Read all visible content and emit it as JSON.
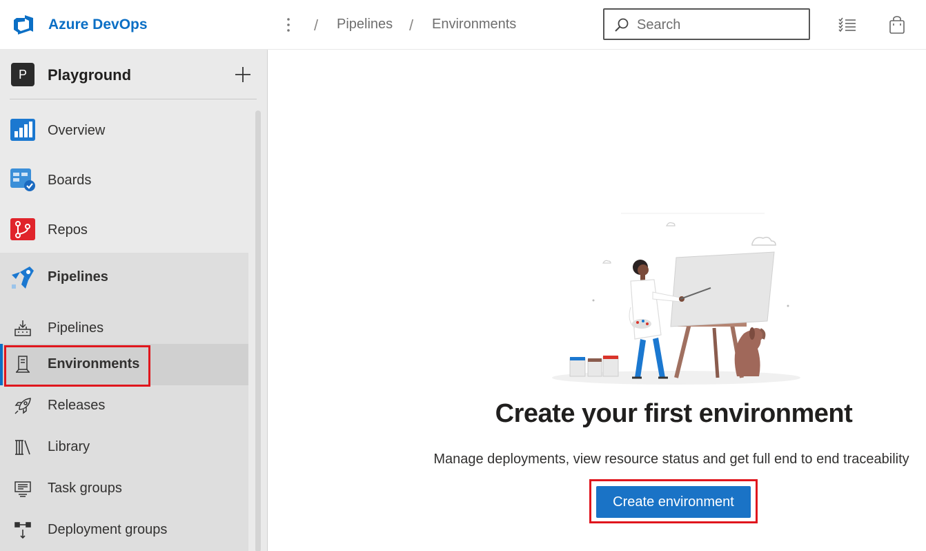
{
  "header": {
    "logo_text": "Azure DevOps",
    "breadcrumb": [
      "Pipelines",
      "Environments"
    ],
    "search_placeholder": "Search",
    "icons": [
      "azure-devops-logo-icon",
      "more-vertical-icon",
      "search-icon",
      "task-list-icon",
      "shopping-bag-icon"
    ]
  },
  "sidebar": {
    "project": {
      "initial": "P",
      "name": "Playground"
    },
    "items": [
      {
        "label": "Overview",
        "icon": "overview-icon"
      },
      {
        "label": "Boards",
        "icon": "boards-icon"
      },
      {
        "label": "Repos",
        "icon": "repos-icon"
      },
      {
        "label": "Pipelines",
        "icon": "pipelines-icon"
      }
    ],
    "sub_items": [
      {
        "label": "Pipelines",
        "icon": "pipelines-sub-icon"
      },
      {
        "label": "Environments",
        "icon": "environments-icon",
        "selected": true
      },
      {
        "label": "Releases",
        "icon": "rocket-icon"
      },
      {
        "label": "Library",
        "icon": "library-icon"
      },
      {
        "label": "Task groups",
        "icon": "task-groups-icon"
      },
      {
        "label": "Deployment groups",
        "icon": "deployment-groups-icon"
      }
    ]
  },
  "main": {
    "title": "Create your first environment",
    "description": "Manage deployments, view resource status and get full end to end traceability",
    "create_button": "Create environment"
  },
  "colors": {
    "brand": "#0b6fc5",
    "button": "#1a73c6",
    "highlight_border": "#e0161d",
    "sidebar_bg": "#eaeaea"
  }
}
